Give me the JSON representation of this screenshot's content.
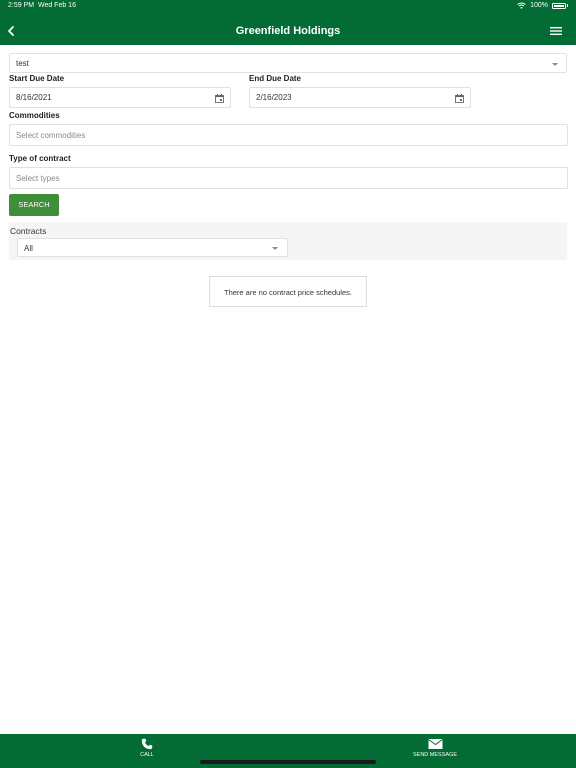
{
  "status_bar": {
    "time": "2:59 PM",
    "date": "Wed Feb 16",
    "battery": "100%"
  },
  "header": {
    "title": "Greenfield Holdings"
  },
  "form": {
    "account_value": "test",
    "start_label": "Start Due Date",
    "start_value": "8/16/2021",
    "end_label": "End Due Date",
    "end_value": "2/16/2023",
    "commodities_label": "Commodities",
    "commodities_placeholder": "Select commodities",
    "type_label": "Type of contract",
    "type_placeholder": "Select types",
    "search_label": "SEARCH"
  },
  "contracts": {
    "label": "Contracts",
    "selected": "All"
  },
  "empty_message": "There are no contract price schedules.",
  "bottom_bar": {
    "call_label": "CALL",
    "message_label": "SEND MESSAGE"
  },
  "colors": {
    "brand_green": "#036b34",
    "button_green": "#3f8e3a"
  }
}
